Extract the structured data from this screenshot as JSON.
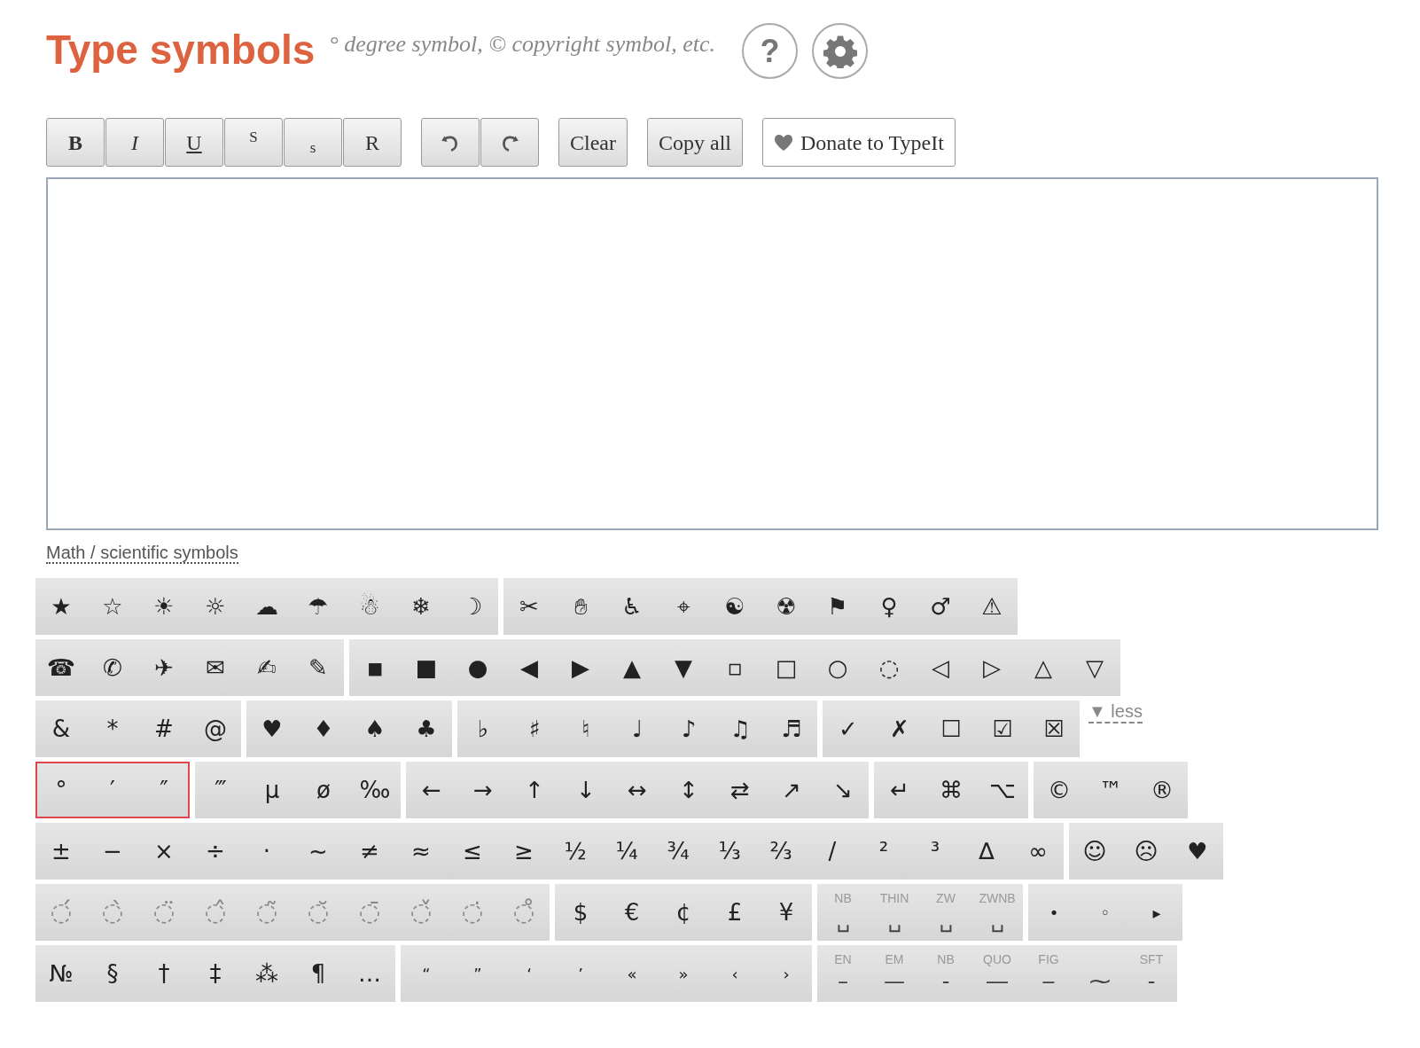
{
  "header": {
    "title": "Type symbols",
    "subtitle": "° degree symbol, © copyright symbol, etc.",
    "help_label": "?"
  },
  "toolbar": [
    {
      "buttons": [
        {
          "kind": "bold",
          "label": "B"
        },
        {
          "kind": "italic",
          "label": "I"
        },
        {
          "kind": "underline",
          "label": "U"
        },
        {
          "kind": "superscript",
          "label": "S"
        },
        {
          "kind": "subscript",
          "label": "s"
        },
        {
          "kind": "regular",
          "label": "R"
        }
      ]
    },
    {
      "buttons": [
        {
          "kind": "undo"
        },
        {
          "kind": "redo"
        }
      ]
    },
    {
      "buttons": [
        {
          "kind": "text",
          "label": "Clear"
        }
      ]
    },
    {
      "buttons": [
        {
          "kind": "text",
          "label": "Copy all"
        }
      ]
    },
    {
      "buttons": [
        {
          "kind": "donate",
          "label": "Donate to TypeIt"
        }
      ]
    }
  ],
  "category_link": "Math / scientific symbols",
  "rows": [
    {
      "groups": [
        {
          "kind": "plain",
          "selected": false,
          "keys": [
            "★",
            "☆",
            "☀",
            "☼",
            "☁",
            "☂",
            "☃",
            "❄",
            "☽"
          ]
        },
        {
          "kind": "plain",
          "selected": false,
          "keys": [
            "✂",
            "✋",
            "♿",
            "⌖",
            "☯",
            "☢",
            "⚑",
            "♀",
            "♂",
            "⚠"
          ]
        }
      ]
    },
    {
      "groups": [
        {
          "kind": "plain",
          "selected": false,
          "keys": [
            "☎",
            "✆",
            "✈",
            "✉",
            "✍",
            "✎"
          ]
        },
        {
          "kind": "plain",
          "selected": false,
          "keys": [
            "◾",
            "■",
            "●",
            "◀",
            "▶",
            "▲",
            "▼",
            "▫",
            "□",
            "○",
            "◌",
            "◁",
            "▷",
            "△",
            "▽"
          ]
        }
      ]
    },
    {
      "groups": [
        {
          "kind": "plain",
          "selected": false,
          "keys": [
            "&",
            "*",
            "#",
            "@"
          ]
        },
        {
          "kind": "plain",
          "selected": false,
          "keys": [
            "♥",
            "♦",
            "♠",
            "♣"
          ]
        },
        {
          "kind": "plain",
          "selected": false,
          "keys": [
            "♭",
            "♯",
            "♮",
            "♩",
            "♪",
            "♫",
            "♬"
          ]
        },
        {
          "kind": "plain",
          "selected": false,
          "keys": [
            "✓",
            "✗",
            "☐",
            "☑",
            "☒"
          ]
        }
      ],
      "toggle_link": "▼ less"
    },
    {
      "groups": [
        {
          "kind": "plain",
          "selected": true,
          "keys": [
            "°",
            "′",
            "″"
          ]
        },
        {
          "kind": "plain",
          "selected": false,
          "keys": [
            "‴",
            "μ",
            "ø",
            "‰"
          ]
        },
        {
          "kind": "plain",
          "selected": false,
          "keys": [
            "←",
            "→",
            "↑",
            "↓",
            "↔",
            "↕",
            "⇄",
            "↗",
            "↘"
          ]
        },
        {
          "kind": "plain",
          "selected": false,
          "keys": [
            "↵",
            "⌘",
            "⌥"
          ]
        },
        {
          "kind": "plain",
          "selected": false,
          "keys": [
            "©",
            "™",
            "®"
          ]
        }
      ]
    },
    {
      "groups": [
        {
          "kind": "plain",
          "selected": false,
          "keys": [
            "±",
            "−",
            "×",
            "÷",
            "·",
            "~",
            "≠",
            "≈",
            "≤",
            "≥",
            "½",
            "¼",
            "¾",
            "⅓",
            "⅔",
            "/",
            "²",
            "³",
            "∆",
            "∞"
          ]
        },
        {
          "kind": "plain",
          "selected": false,
          "keys": [
            "☺",
            "☹",
            "♥"
          ]
        }
      ]
    },
    {
      "groups": [
        {
          "kind": "combining",
          "selected": false,
          "keys": [
            "◌́",
            "◌̀",
            "◌̈",
            "◌̂",
            "◌̃",
            "◌̆",
            "◌̄",
            "◌̌",
            "◌̇",
            "◌̊"
          ]
        },
        {
          "kind": "plain",
          "selected": false,
          "keys": [
            "$",
            "€",
            "¢",
            "£",
            "¥"
          ]
        },
        {
          "kind": "captioned",
          "selected": false,
          "keys": [
            {
              "label": "NB",
              "symbol": "␣"
            },
            {
              "label": "THIN",
              "symbol": "␣"
            },
            {
              "label": "ZW",
              "symbol": "␣"
            },
            {
              "label": "ZWNB",
              "symbol": "␣"
            }
          ]
        },
        {
          "kind": "small",
          "selected": false,
          "keys": [
            "•",
            "◦",
            "▸"
          ]
        }
      ]
    },
    {
      "groups": [
        {
          "kind": "plain",
          "selected": false,
          "keys": [
            "№",
            "§",
            "†",
            "‡",
            "⁂",
            "¶",
            "…"
          ]
        },
        {
          "kind": "small",
          "selected": false,
          "keys": [
            "“",
            "”",
            "‘",
            "’",
            "«",
            "»",
            "‹",
            "›"
          ]
        },
        {
          "kind": "captioned",
          "selected": false,
          "keys": [
            {
              "label": "EN",
              "symbol": "–"
            },
            {
              "label": "EM",
              "symbol": "—"
            },
            {
              "label": "NB",
              "symbol": "‑"
            },
            {
              "label": "QUO",
              "symbol": "―"
            },
            {
              "label": "FIG",
              "symbol": "‒"
            },
            {
              "symbol": "⁓"
            },
            {
              "label": "SFT",
              "symbol": "-"
            }
          ]
        }
      ]
    }
  ]
}
